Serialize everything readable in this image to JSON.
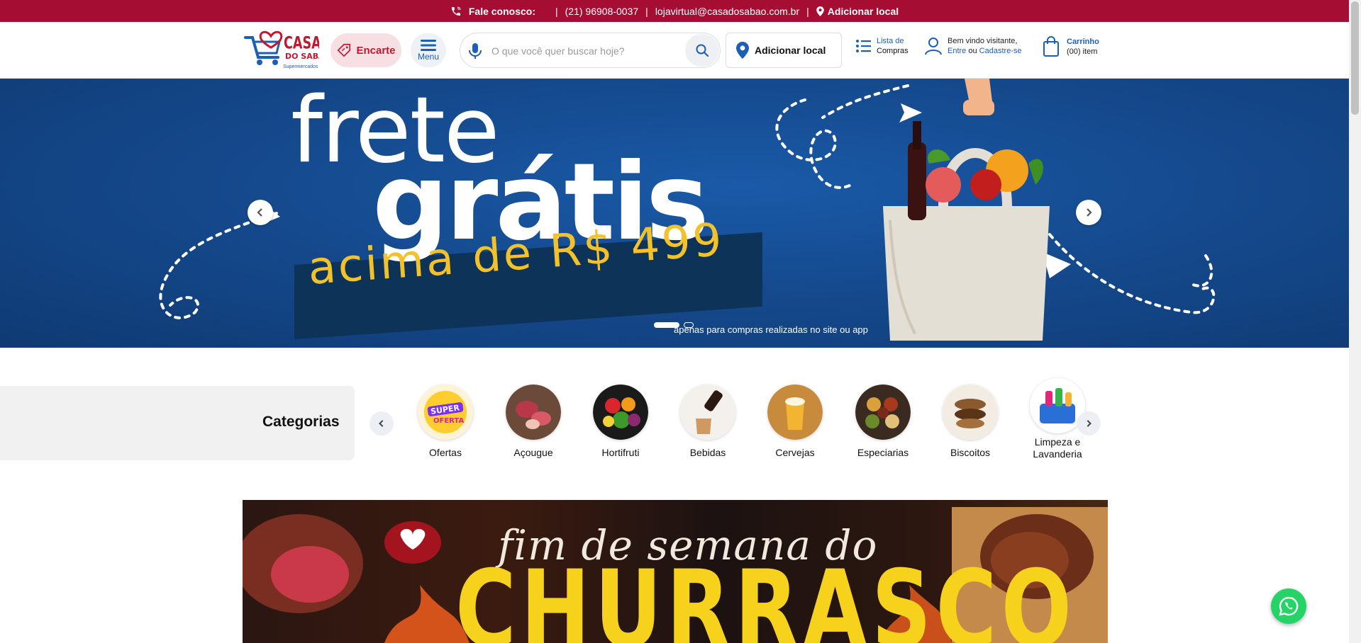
{
  "topbar": {
    "contact_label": "Fale conosco:",
    "phone": "(21) 96908-0037",
    "email": "lojavirtual@casadosabao.com.br",
    "location_link": "Adicionar local",
    "bg_color": "#a50d32"
  },
  "header": {
    "logo_text": "Casa do Sabão Supermercados",
    "encarte_label": "Encarte",
    "menu_label": "Menu",
    "search_placeholder": "O que você quer buscar hoje?",
    "add_location_label": "Adicionar local",
    "list_line1": "Lista de",
    "list_line2": "Compras",
    "user_greeting": "Bem vindo visitante,",
    "user_login": "Entre",
    "user_or": "ou",
    "user_register": "Cadastre-se",
    "cart_label": "Carrinho",
    "cart_count": "(00) item",
    "accent_color": "#1c5fb7"
  },
  "hero": {
    "line1": "frete",
    "line2": "grátis",
    "line3": "acima de R$ 499",
    "footnote": "apenas para compras realizadas no site ou app",
    "slides_total": 2,
    "active_slide": 1
  },
  "categories": {
    "title": "Categorias",
    "items": [
      {
        "label": "Ofertas",
        "icon": "super-oferta-icon"
      },
      {
        "label": "Açougue",
        "icon": "meat-icon"
      },
      {
        "label": "Hortifruti",
        "icon": "vegetables-icon"
      },
      {
        "label": "Bebidas",
        "icon": "drink-icon"
      },
      {
        "label": "Cervejas",
        "icon": "beer-icon"
      },
      {
        "label": "Especiarias",
        "icon": "spices-icon"
      },
      {
        "label": "Biscoitos",
        "icon": "cookies-icon"
      },
      {
        "label": "Limpeza e Lavanderia",
        "icon": "cleaning-icon"
      }
    ]
  },
  "promo_banner": {
    "script_text": "fim de semana do",
    "headline": "CHURRASCO"
  }
}
